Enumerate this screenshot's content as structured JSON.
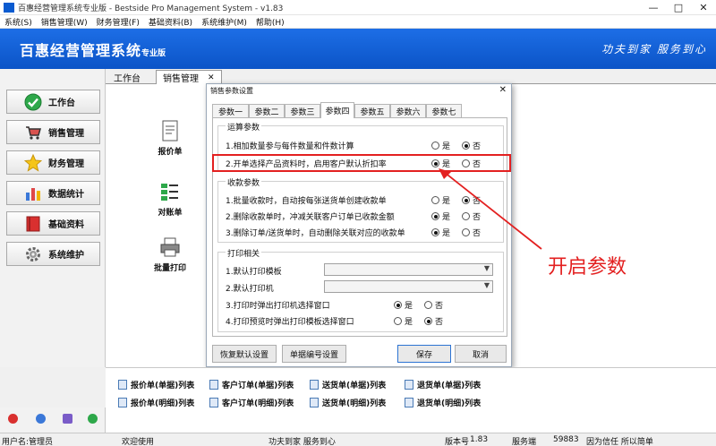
{
  "window": {
    "title": "百惠经营管理系统专业版 - Bestside Pro Management System - v1.83",
    "controls": [
      "—",
      "□",
      "✕"
    ]
  },
  "menu": [
    "系统(S)",
    "销售管理(W)",
    "财务管理(F)",
    "基础资料(B)",
    "系统维护(M)",
    "帮助(H)"
  ],
  "banner": {
    "brand": "百惠经营管理系统",
    "brand_suffix": "专业版",
    "slogan": "功夫到家  服务到心"
  },
  "sidebar": {
    "items": [
      {
        "label": "工作台",
        "icon": "check-icon"
      },
      {
        "label": "销售管理",
        "icon": "cart-icon"
      },
      {
        "label": "财务管理",
        "icon": "star-icon"
      },
      {
        "label": "数据统计",
        "icon": "bar-chart-icon"
      },
      {
        "label": "基础资料",
        "icon": "book-icon"
      },
      {
        "label": "系统维护",
        "icon": "gear-icon"
      }
    ]
  },
  "tabs": [
    {
      "label": "工作台",
      "active": false
    },
    {
      "label": "销售管理",
      "active": true,
      "close": "✕"
    }
  ],
  "tools": [
    {
      "label": "报价单",
      "icon": "document-icon"
    },
    {
      "label": "对账单",
      "icon": "checklist-icon"
    },
    {
      "label": "批量打印",
      "icon": "printer-icon"
    }
  ],
  "dialog": {
    "title": "销售参数设置",
    "close": "✕",
    "tabs": [
      "参数一",
      "参数二",
      "参数三",
      "参数四",
      "参数五",
      "参数六",
      "参数七"
    ],
    "active_tab": "参数四",
    "groups": {
      "calc": {
        "title": "运算参数",
        "rows": [
          {
            "label": "1.相加数量参与每件数量和件数计算",
            "yes": "是",
            "no": "否",
            "value": "no"
          },
          {
            "label": "2.开单选择产品资料时，启用客户默认折扣率",
            "yes": "是",
            "no": "否",
            "value": "yes"
          }
        ]
      },
      "collect": {
        "title": "收款参数",
        "rows": [
          {
            "label": "1.批量收款时，自动按每张送货单创建收款单",
            "yes": "是",
            "no": "否",
            "value": "no"
          },
          {
            "label": "2.删除收款单时，冲减关联客户订单已收款金额",
            "yes": "是",
            "no": "否",
            "value": "yes"
          },
          {
            "label": "3.删除订单/送货单时，自动删除关联对应的收款单",
            "yes": "是",
            "no": "否",
            "value": "yes"
          }
        ]
      },
      "print": {
        "title": "打印相关",
        "selects": [
          {
            "label": "1.默认打印模板",
            "value": ""
          },
          {
            "label": "2.默认打印机",
            "value": ""
          }
        ],
        "rows": [
          {
            "label": "3.打印时弹出打印机选择窗口",
            "yes": "是",
            "no": "否",
            "value": "yes"
          },
          {
            "label": "4.打印预览时弹出打印模板选择窗口",
            "yes": "是",
            "no": "否",
            "value": "no"
          }
        ]
      }
    },
    "buttons": {
      "restore": "恢复默认设置",
      "numbering": "单据编号设置",
      "save": "保存",
      "cancel": "取消"
    }
  },
  "annotation": {
    "text": "开启参数",
    "color": "#e32020"
  },
  "bottom_links": [
    [
      "报价单(单据)列表",
      "客户订单(单据)列表",
      "送货单(单据)列表",
      "退货单(单据)列表"
    ],
    [
      "报价单(明细)列表",
      "客户订单(明细)列表",
      "送货单(明细)列表",
      "退货单(明细)列表"
    ]
  ],
  "statusbar": {
    "user": "用户名:管理员",
    "welcome": "欢迎使用",
    "slogan": "功夫到家 服务到心",
    "version_label": "版本号",
    "version": "1.83",
    "server_label": "服务端",
    "server_port": "59883",
    "motto": "因为信任 所以简单"
  },
  "colors": {
    "banner": "#0b54c7",
    "accent_red": "#e32020",
    "primary_button": "#2c73d2"
  }
}
